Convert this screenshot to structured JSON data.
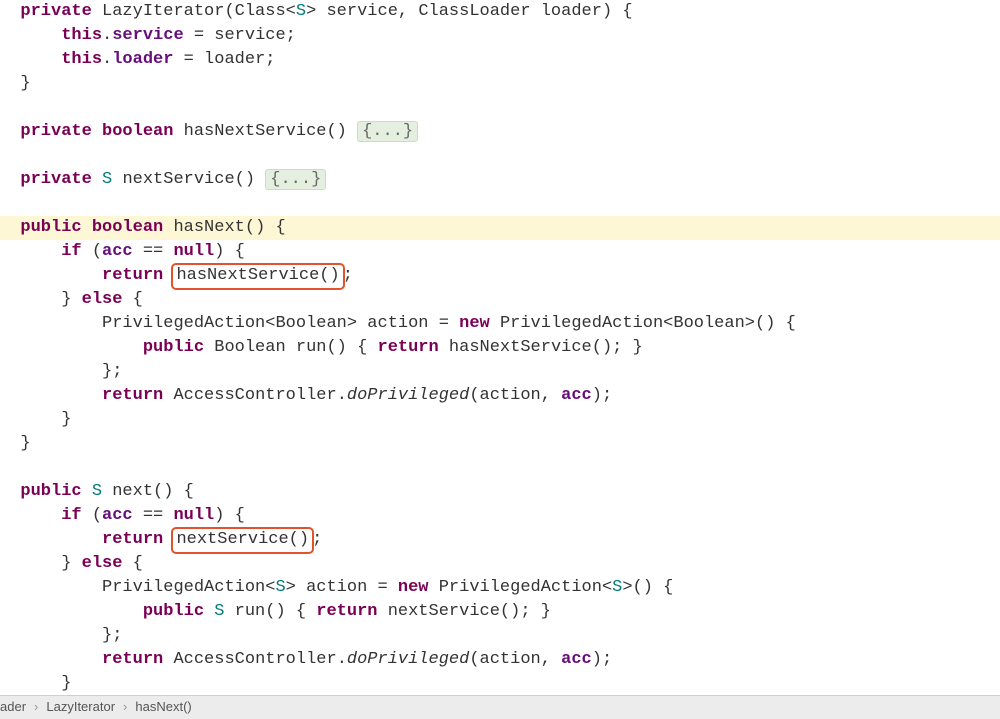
{
  "code": {
    "l1_private": "private",
    "l1_ctor": "LazyIterator",
    "l1_class": "Class",
    "l1_s": "S",
    "l1_svc_param": "service",
    "l1_cl": "ClassLoader",
    "l1_loader_param": "loader",
    "l2_this": "this",
    "l2_service": "service",
    "l2_eq": " = service;",
    "l3_this": "this",
    "l3_loader": "loader",
    "l3_eq": " = loader;",
    "l6_private": "private",
    "l6_bool": "boolean",
    "l6_name": "hasNextService",
    "fold": "{...}",
    "l8_private": "private",
    "l8_s": "S",
    "l8_name": "nextService",
    "l10_public": "public",
    "l10_bool": "boolean",
    "l10_name": "hasNext",
    "l11_if": "if",
    "l11_acc": "acc",
    "l11_null": "null",
    "l12_return": "return",
    "l12_box": "hasNextService()",
    "l13_else": "else",
    "l14_pa": "PrivilegedAction",
    "l14_bool": "Boolean",
    "l14_action": "action",
    "l14_new": "new",
    "l15_public": "public",
    "l15_bool": "Boolean",
    "l15_run": "run",
    "l15_return": "return",
    "l15_call": "hasNextService(); }",
    "l17_return": "return",
    "l17_ac": "AccessController",
    "l17_do": "doPrivileged",
    "l17_args": "action",
    "l17_acc": "acc",
    "l21_public": "public",
    "l21_s": "S",
    "l21_next": "next",
    "l22_if": "if",
    "l22_acc": "acc",
    "l22_null": "null",
    "l23_return": "return",
    "l23_box": "nextService()",
    "l24_else": "else",
    "l25_pa": "PrivilegedAction",
    "l25_s": "S",
    "l25_action": "action",
    "l25_new": "new",
    "l26_public": "public",
    "l26_s": "S",
    "l26_run": "run",
    "l26_return": "return",
    "l26_call": "nextService(); }",
    "l28_return": "return",
    "l28_ac": "AccessController",
    "l28_do": "doPrivileged",
    "l28_args": "action",
    "l28_acc": "acc"
  },
  "breadcrumb": {
    "b1": "ader",
    "b2": "LazyIterator",
    "b3": "hasNext()"
  }
}
